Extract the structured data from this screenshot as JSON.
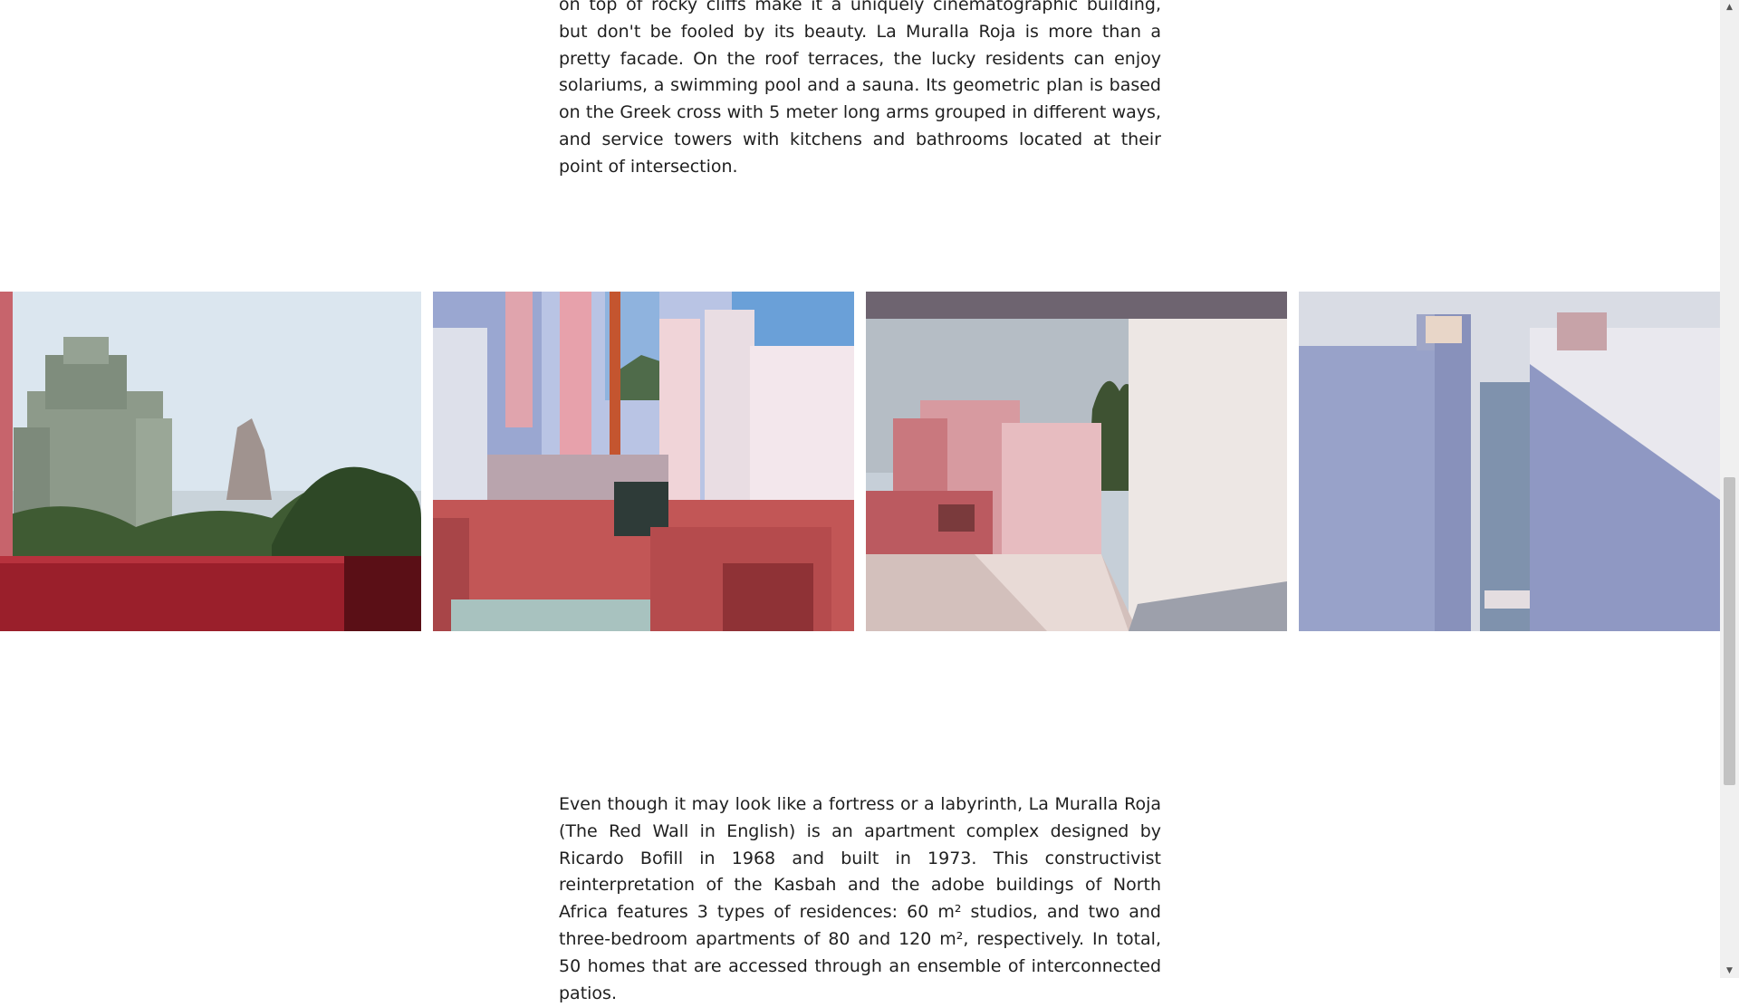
{
  "article": {
    "paragraph_top": "on top of rocky cliffs make it a uniquely cinematographic building, but don't be fooled by its beauty. La Muralla Roja is more than a pretty facade. On the roof terraces, the lucky residents can enjoy solariums, a swimming pool and a sauna. Its geometric plan is based on the Greek cross with 5 meter long arms grouped in different ways, and service towers with kitchens and bathrooms located at their point of intersection.",
    "paragraph_bottom": "Even though it may look like a fortress or a labyrinth, La Muralla Roja (The Red Wall in English) is an apartment complex designed by Ricardo Bofill in 1968 and built in 1973. This constructivist reinterpretation of the Kasbah and the adobe buildings of North Africa features 3 types of residences: 60 m² studios, and two and three-bedroom apartments of 80 and 120 m², respectively. In total, 50 homes that are accessed through an ensemble of interconnected patios."
  },
  "gallery": {
    "photos": [
      {
        "subject": "green-apartment-building-with-rock"
      },
      {
        "subject": "pink-red-blue-staircases"
      },
      {
        "subject": "pink-terrace-sea-view"
      },
      {
        "subject": "blue-walls-sea-gap"
      }
    ]
  },
  "colors": {
    "red_wall": "#b23a44",
    "pink": "#e2a7ab",
    "blue_wall": "#8e97be",
    "sky": "#c7d7e6",
    "sea": "#9fb1c4"
  },
  "scrollbar": {
    "up_icon": "▲",
    "down_icon": "▼"
  }
}
